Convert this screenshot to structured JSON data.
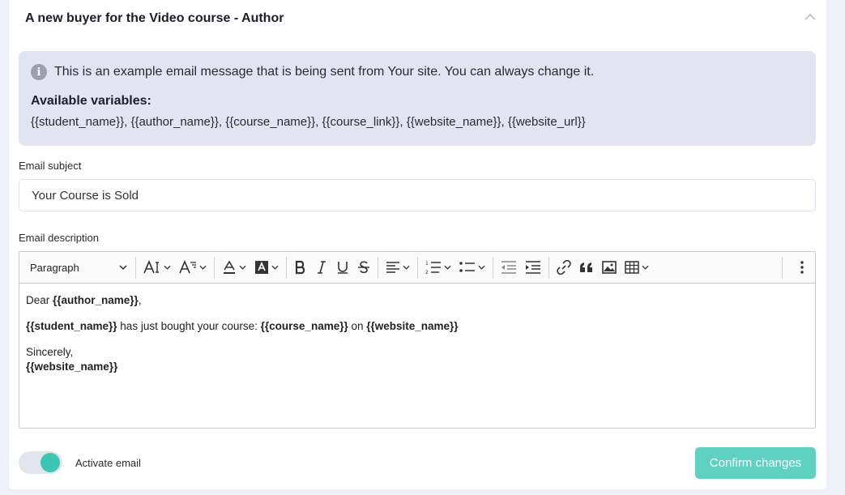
{
  "card": {
    "title": "A new buyer for the Video course - Author"
  },
  "info": {
    "message": "This is an example email message that is being sent from Your site. You can always change it.",
    "vars_title": "Available variables:",
    "vars_list": "{{student_name}}, {{author_name}}, {{course_name}}, {{course_link}}, {{website_name}}, {{website_url}}"
  },
  "subject": {
    "label": "Email subject",
    "value": "Your Course is Sold"
  },
  "description": {
    "label": "Email description",
    "paragraph_select": "Paragraph",
    "body": {
      "line1_prefix": "Dear ",
      "line1_var": "{{author_name}}",
      "line1_suffix": ",",
      "line2_var1": "{{student_name}}",
      "line2_text1": " has just bought your course: ",
      "line2_var2": "{{course_name}}",
      "line2_text2": " on ",
      "line2_var3": "{{website_name}}",
      "closing": "Sincerely,",
      "signature": "{{website_name}}"
    }
  },
  "footer": {
    "toggle_label": "Activate email",
    "toggle_on": true,
    "confirm_label": "Confirm changes"
  },
  "colors": {
    "accent": "#3ec6b5",
    "button": "#5fd1c3",
    "info_bg": "#e2e4ef"
  }
}
